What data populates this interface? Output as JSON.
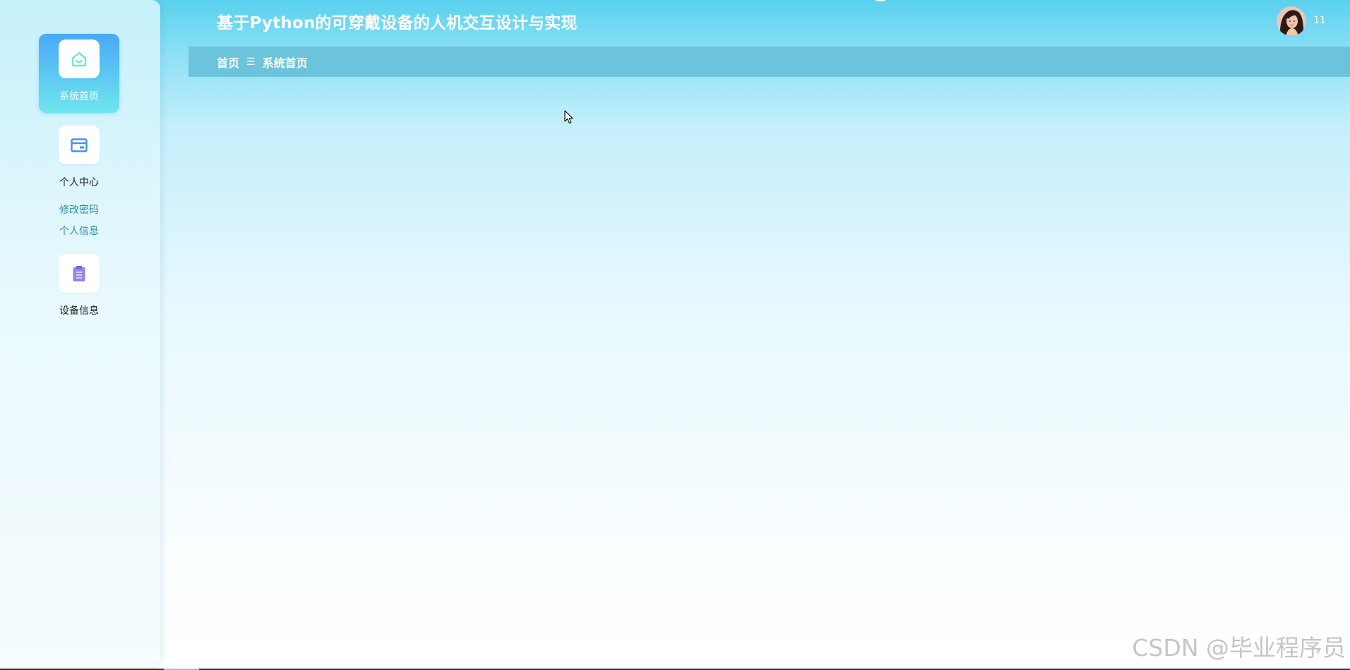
{
  "header": {
    "title": "基于Python的可穿戴设备的人机交互设计与实现",
    "username": "11"
  },
  "breadcrumb": {
    "home": "首页",
    "separator": "☰",
    "current": "系统首页"
  },
  "sidebar": {
    "items": [
      {
        "label": "系统首页",
        "icon": "home-icon",
        "active": true
      },
      {
        "label": "个人中心",
        "icon": "wallet-icon",
        "active": false,
        "children": [
          "修改密码",
          "个人信息"
        ]
      },
      {
        "label": "设备信息",
        "icon": "clipboard-icon",
        "active": false
      }
    ]
  },
  "watermark": "CSDN @毕业程序员",
  "colors": {
    "header_top": "#59d1ee",
    "breadcrumb_bg": "#6cc4dc",
    "active_gradient_top": "#4aa8f7",
    "active_gradient_bottom": "#6ee6ee",
    "home_icon": "#6ee6c8",
    "wallet_icon": "#4a90e2",
    "clipboard_icon": "#9b82e8",
    "submenu_text": "#2e8cb3"
  }
}
